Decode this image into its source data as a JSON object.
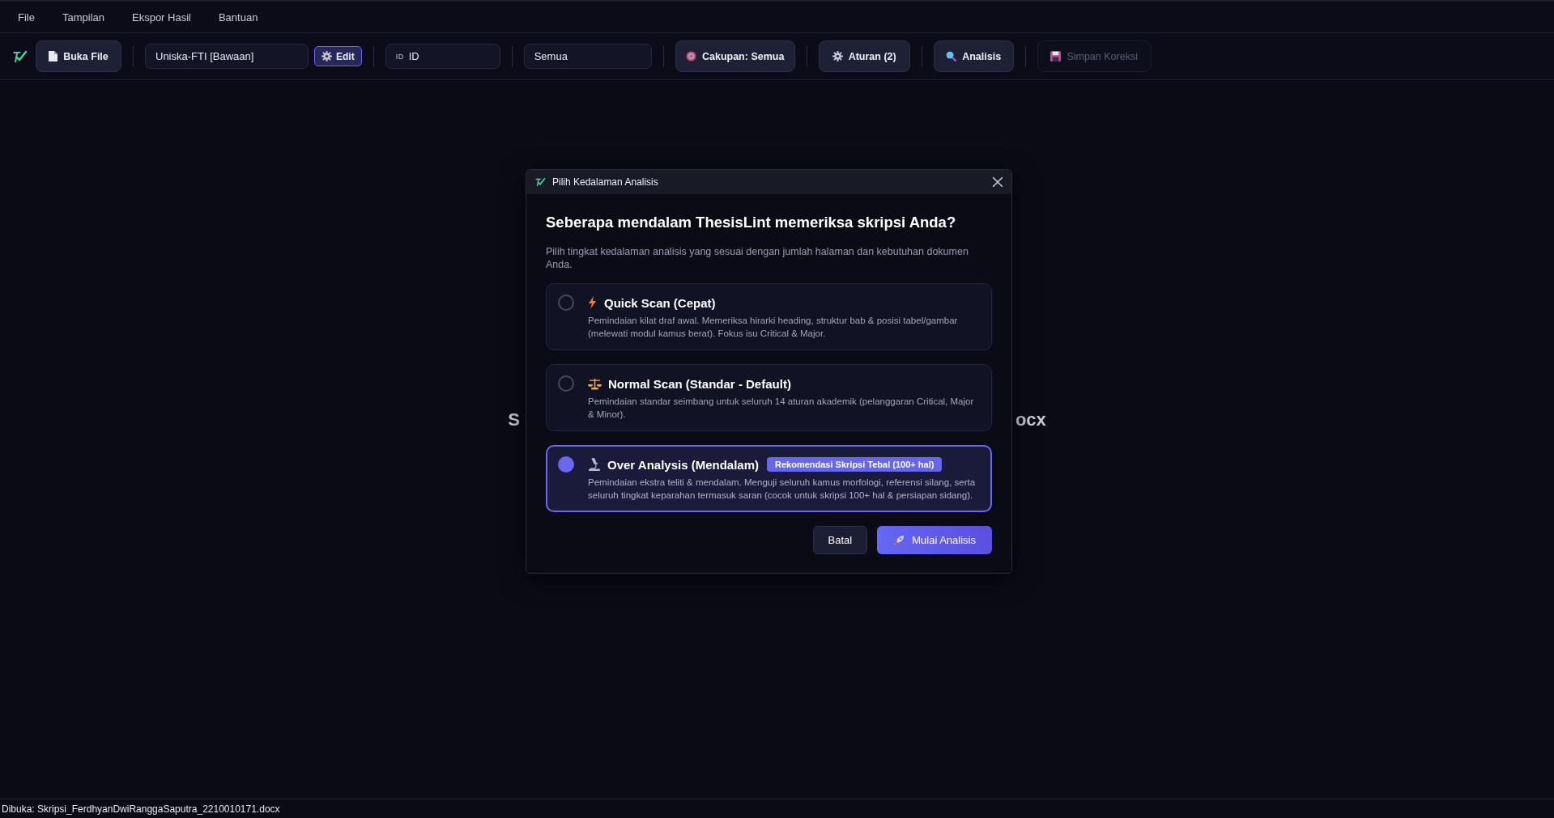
{
  "menu": [
    {
      "label": "File"
    },
    {
      "label": "Tampilan"
    },
    {
      "label": "Ekspor Hasil"
    },
    {
      "label": "Bantuan"
    }
  ],
  "toolbar": {
    "open_button": {
      "label": "Buka File"
    },
    "profile_select": {
      "value": "Uniska-FTI [Bawaan]"
    },
    "edit_button": {
      "label": "Edit"
    },
    "language_select": {
      "prefix": "ID",
      "value": "ID"
    },
    "filter_select": {
      "value": "Semua"
    },
    "scope_button": {
      "label": "Cakupan: Semua"
    },
    "rules_button": {
      "label": "Aturan (2)"
    },
    "analyze_button": {
      "label": "Analisis"
    },
    "save_button": {
      "label": "Simpan Koreksi",
      "disabled": true
    }
  },
  "background_heading": {
    "left_fragment": "S",
    "right_fragment": "ocx"
  },
  "dialog": {
    "title": "Pilih Kedalaman Analisis",
    "heading": "Seberapa mendalam ThesisLint memeriksa skripsi Anda?",
    "description": "Pilih tingkat kedalaman analisis yang sesuai dengan jumlah halaman dan kebutuhan dokumen Anda.",
    "options": [
      {
        "title": "Quick Scan (Cepat)",
        "description": "Pemindaian kilat draf awal. Memeriksa hirarki heading, struktur bab & posisi tabel/gambar (melewati modul kamus berat). Fokus isu Critical & Major.",
        "selected": false
      },
      {
        "title": "Normal Scan (Standar - Default)",
        "description": "Pemindaian standar seimbang untuk seluruh 14 aturan akademik (pelanggaran Critical, Major & Minor).",
        "selected": false
      },
      {
        "title": "Over Analysis (Mendalam)",
        "badge": "Rekomendasi Skripsi Tebal (100+ hal)",
        "description": "Pemindaian ekstra teliti & mendalam. Menguji seluruh kamus morfologi, referensi silang, serta seluruh tingkat keparahan termasuk saran (cocok untuk skripsi 100+ hal & persiapan sidang).",
        "selected": true
      }
    ],
    "cancel_button": "Batal",
    "start_button": "Mulai Analisis"
  },
  "status_bar": {
    "text": "Dibuka: Skripsi_FerdhyanDwiRanggaSaputra_2210010171.docx"
  }
}
